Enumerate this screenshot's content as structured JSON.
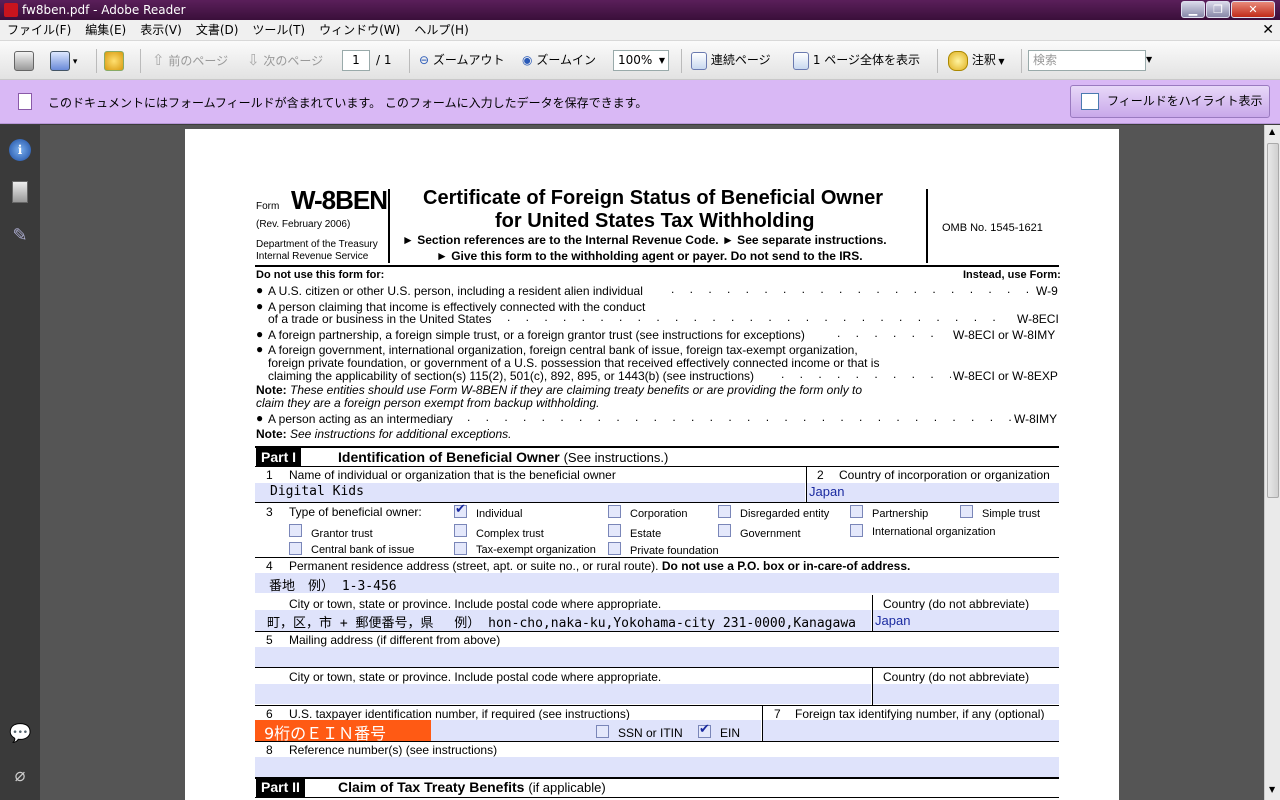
{
  "window": {
    "title": "fw8ben.pdf - Adobe Reader"
  },
  "menu": [
    "ファイル(F)",
    "編集(E)",
    "表示(V)",
    "文書(D)",
    "ツール(T)",
    "ウィンドウ(W)",
    "ヘルプ(H)"
  ],
  "toolbar": {
    "prev_page": "前のページ",
    "next_page": "次のページ",
    "page_current": "1",
    "page_total": "/ 1",
    "zoom_out": "ズームアウト",
    "zoom_in": "ズームイン",
    "zoom_level": "100%",
    "continuous": "連続ページ",
    "fit_page": "1 ページ全体を表示",
    "comment": "注釈",
    "search_placeholder": "検索"
  },
  "notice": {
    "text": "このドキュメントにはフォームフィールドが含まれています。 このフォームに入力したデータを保存できます。",
    "highlight_button": "フィールドをハイライト表示"
  },
  "form": {
    "form_word": "Form",
    "form_id": "W-8BEN",
    "rev": "(Rev. February 2006)",
    "dept1": "Department of the Treasury",
    "dept2": "Internal Revenue Service",
    "title1": "Certificate of Foreign Status of Beneficial Owner",
    "title2": "for United States Tax Withholding",
    "sub1": "► Section references are to the Internal Revenue Code.   ► See separate instructions.",
    "sub2": "► Give this form to the withholding agent or payer. Do not send to the IRS.",
    "omb": "OMB No. 1545-1621",
    "do_not_use": "Do not use this form for:",
    "instead": "Instead, use Form:",
    "b1": "A U.S. citizen or other U.S. person, including a resident alien individual",
    "b1f": "W-9",
    "b2a": "A person claiming that income is effectively connected with the conduct",
    "b2b": "of a trade or business in the United States",
    "b2f": "W-8ECI",
    "b3": "A foreign partnership, a foreign simple trust, or a foreign grantor trust (see instructions for exceptions)",
    "b3f": "W-8ECI or W-8IMY",
    "b4a": "A foreign government, international organization, foreign central bank of issue, foreign tax-exempt organization,",
    "b4b": "foreign private foundation, or government of a U.S. possession that received effectively connected income or that is",
    "b4c": "claiming the applicability of section(s) 115(2), 501(c), 892, 895, or 1443(b) (see instructions)",
    "b4f": "W-8ECI or W-8EXP",
    "note1_label": "Note:",
    "note1a": "These entities should use Form W-8BEN if they are claiming treaty benefits or are providing the form only to",
    "note1b": "claim they are a foreign person exempt from backup withholding.",
    "b5": "A person acting as an intermediary",
    "b5f": "W-8IMY",
    "note2_label": "Note:",
    "note2": "See instructions for additional exceptions.",
    "part1_label": "Part I",
    "part1_title": "Identification of Beneficial Owner",
    "part1_hint": "(See instructions.)",
    "l1": "Name of individual or organization that is the beneficial owner",
    "l1_value": "Digital Kids",
    "l2": "Country of incorporation or organization",
    "l2_value": "Japan",
    "l3": "Type of beneficial owner:",
    "owner_types": {
      "individual": "Individual",
      "corporation": "Corporation",
      "disregarded": "Disregarded entity",
      "partnership": "Partnership",
      "simple_trust": "Simple trust",
      "grantor_trust": "Grantor trust",
      "complex_trust": "Complex trust",
      "estate": "Estate",
      "government": "Government",
      "intl_org": "International organization",
      "central_bank": "Central bank of issue",
      "tax_exempt": "Tax-exempt organization",
      "private_foundation": "Private foundation"
    },
    "l4": "Permanent residence address (street, apt. or suite no., or rural route).",
    "l4_bold": "Do not use a P.O. box or in-care-of address.",
    "l4_value": "番地　例） 1-3-456",
    "city_label": "City or town, state or province. Include postal code where appropriate.",
    "country_label": "Country (do not abbreviate)",
    "city_value": "町，区，市 + 郵便番号，県　 例） hon-cho,naka-ku,Yokohama-city 231-0000,Kanagawa",
    "country_value": "Japan",
    "l5": "Mailing address (if different from above)",
    "city2_label": "City or town, state or province. Include postal code where appropriate.",
    "country2_label": "Country (do not abbreviate)",
    "l6": "U.S. taxpayer identification number, if required (see instructions)",
    "l6_value": "9桁のＥＩＮ番号",
    "ssn": "SSN or ITIN",
    "ein": "EIN",
    "l7": "Foreign tax identifying number, if any (optional)",
    "l8": "Reference number(s) (see instructions)",
    "part2_label": "Part II",
    "part2_title": "Claim of Tax Treaty Benefits",
    "part2_hint": "(if applicable)",
    "n1": "1",
    "n2": "2",
    "n3": "3",
    "n4": "4",
    "n5": "5",
    "n6": "6",
    "n7": "7",
    "n8": "8"
  }
}
